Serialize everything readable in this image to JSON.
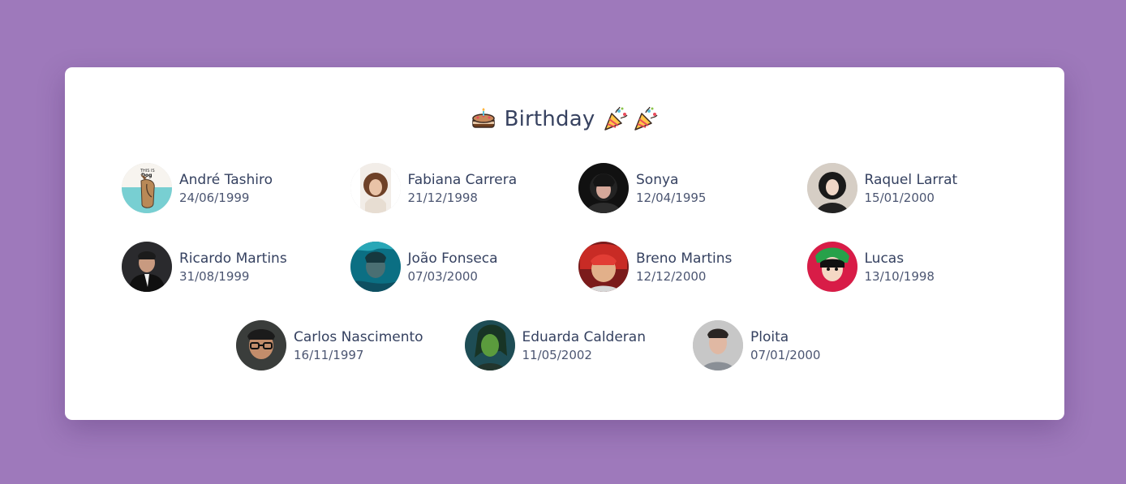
{
  "title": {
    "text": "Birthday",
    "leading_emoji": "birthday-cake-icon",
    "trailing_emojis": [
      "party-popper-icon",
      "party-popper-icon"
    ]
  },
  "colors": {
    "background": "#9e79bb",
    "card": "#ffffff",
    "text_primary": "#354160",
    "text_secondary": "#4c5672"
  },
  "people": [
    {
      "name": "André Tashiro",
      "date": "24/06/1999",
      "avatar": "dog-avatar"
    },
    {
      "name": "Fabiana Carrera",
      "date": "21/12/1998",
      "avatar": "curly-hair-avatar"
    },
    {
      "name": "Sonya",
      "date": "12/04/1995",
      "avatar": "dark-hair-avatar"
    },
    {
      "name": "Raquel Larrat",
      "date": "15/01/2000",
      "avatar": "black-hair-avatar"
    },
    {
      "name": "Ricardo Martins",
      "date": "31/08/1999",
      "avatar": "suit-avatar"
    },
    {
      "name": "João Fonseca",
      "date": "07/03/2000",
      "avatar": "underwater-avatar"
    },
    {
      "name": "Breno Martins",
      "date": "12/12/2000",
      "avatar": "red-hair-anime-avatar"
    },
    {
      "name": "Lucas",
      "date": "13/10/1998",
      "avatar": "green-hat-anime-avatar"
    },
    {
      "name": "Carlos Nascimento",
      "date": "16/11/1997",
      "avatar": "glasses-avatar"
    },
    {
      "name": "Eduarda Calderan",
      "date": "11/05/2002",
      "avatar": "green-character-avatar"
    },
    {
      "name": "Ploita",
      "date": "07/01/2000",
      "avatar": "gray-shirt-avatar"
    }
  ]
}
